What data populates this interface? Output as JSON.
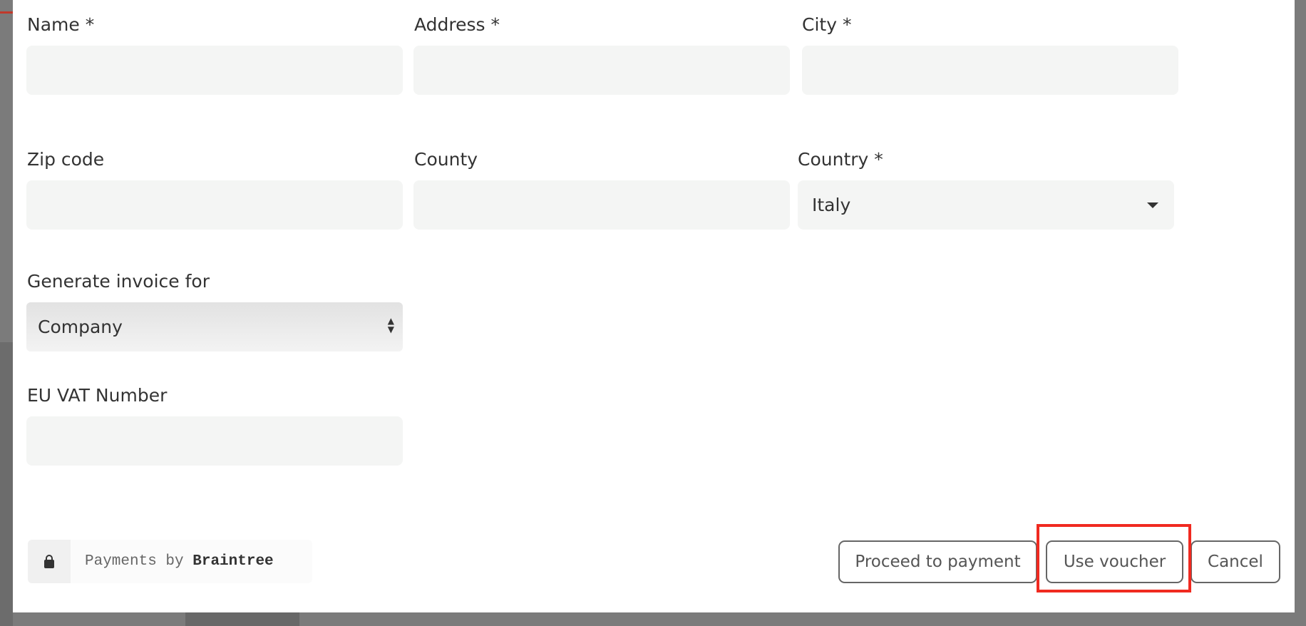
{
  "form": {
    "name_label": "Name *",
    "name_value": "",
    "address_label": "Address *",
    "address_value": "",
    "city_label": "City *",
    "city_value": "",
    "zip_label": "Zip code",
    "zip_value": "",
    "county_label": "County",
    "county_value": "",
    "country_label": "Country *",
    "country_value": "Italy",
    "invoice_label": "Generate invoice for",
    "invoice_value": "Company",
    "vat_label": "EU VAT Number",
    "vat_value": ""
  },
  "footer": {
    "payments_by": "Payments by",
    "provider": "Braintree",
    "proceed_label": "Proceed to payment",
    "voucher_label": "Use voucher",
    "cancel_label": "Cancel"
  },
  "highlight_color": "#f02a20"
}
